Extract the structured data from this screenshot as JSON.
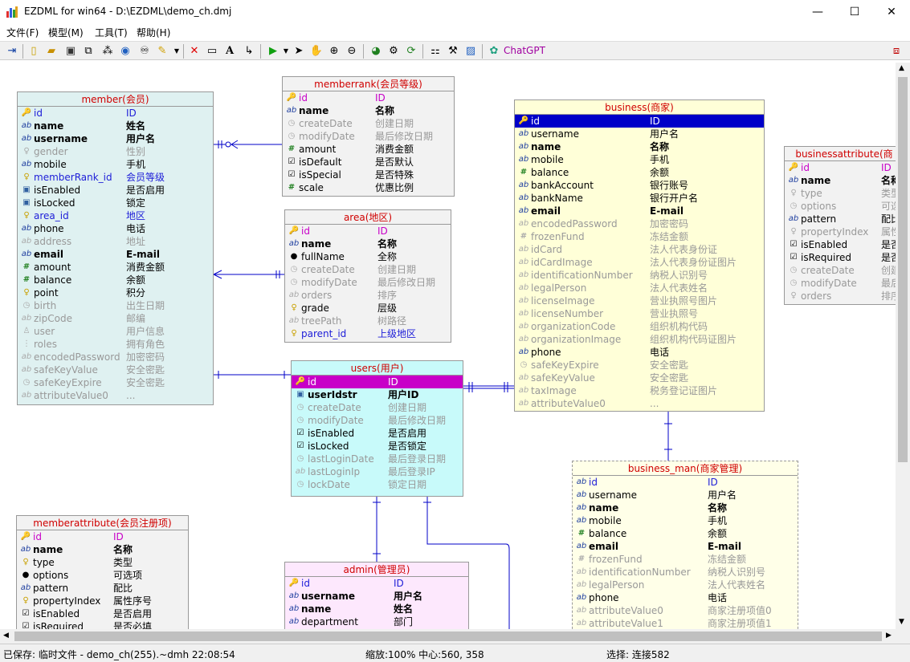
{
  "window": {
    "title": "EZDML for win64 - D:\\EZDML\\demo_ch.dmj",
    "min": "—",
    "max": "☐",
    "close": "✕"
  },
  "menu": [
    "文件(F)",
    "模型(M)",
    "工具(T)",
    "帮助(H)"
  ],
  "toolbar": {
    "chatgpt": "ChatGPT"
  },
  "status": {
    "saved": "已保存: 临时文件 - demo_ch(255).~dmh 22:08:54",
    "zoom": "缩放:100% 中心:560, 358",
    "select": "选择: 连接582"
  },
  "tables": {
    "member": {
      "title": "member(会员)",
      "rows": [
        {
          "i": "🔑",
          "n": "id",
          "d": "ID",
          "c": "bl"
        },
        {
          "i": "ab",
          "n": "name",
          "d": "姓名",
          "c": "b"
        },
        {
          "i": "ab",
          "n": "username",
          "d": "用户名",
          "c": "b"
        },
        {
          "i": "♀",
          "n": "gender",
          "d": "性别",
          "c": "g"
        },
        {
          "i": "ab",
          "n": "mobile",
          "d": "手机",
          "c": ""
        },
        {
          "i": "♀",
          "n": "memberRank_id",
          "d": "会员等级",
          "c": "bl"
        },
        {
          "i": "▣",
          "n": "isEnabled",
          "d": "是否启用",
          "c": ""
        },
        {
          "i": "▣",
          "n": "isLocked",
          "d": "锁定",
          "c": ""
        },
        {
          "i": "♀",
          "n": "area_id",
          "d": "地区",
          "c": "bl"
        },
        {
          "i": "ab",
          "n": "phone",
          "d": "电话",
          "c": ""
        },
        {
          "i": "ab",
          "n": "address",
          "d": "地址",
          "c": "g"
        },
        {
          "i": "ab",
          "n": "email",
          "d": "E-mail",
          "c": "b"
        },
        {
          "i": "#",
          "n": "amount",
          "d": "消费金额",
          "c": ""
        },
        {
          "i": "#",
          "n": "balance",
          "d": "余额",
          "c": ""
        },
        {
          "i": "♀",
          "n": "point",
          "d": "积分",
          "c": ""
        },
        {
          "i": "◷",
          "n": "birth",
          "d": "出生日期",
          "c": "g"
        },
        {
          "i": "ab",
          "n": "zipCode",
          "d": "邮编",
          "c": "g"
        },
        {
          "i": "♙",
          "n": "user",
          "d": "用户信息",
          "c": "g"
        },
        {
          "i": "⋮",
          "n": "roles",
          "d": "拥有角色",
          "c": "g"
        },
        {
          "i": "ab",
          "n": "encodedPassword",
          "d": "加密密码",
          "c": "g"
        },
        {
          "i": "ab",
          "n": "safeKeyValue",
          "d": "安全密匙",
          "c": "g"
        },
        {
          "i": "◷",
          "n": "safeKeyExpire",
          "d": "安全密匙",
          "c": "g"
        },
        {
          "i": "ab",
          "n": "attributeValue0",
          "d": "...",
          "c": "g"
        }
      ]
    },
    "memberrank": {
      "title": "memberrank(会员等级)",
      "rows": [
        {
          "i": "🔑",
          "n": "id",
          "d": "ID",
          "c": "pk"
        },
        {
          "i": "ab",
          "n": "name",
          "d": "名称",
          "c": "b"
        },
        {
          "i": "◷",
          "n": "createDate",
          "d": "创建日期",
          "c": "g"
        },
        {
          "i": "◷",
          "n": "modifyDate",
          "d": "最后修改日期",
          "c": "g"
        },
        {
          "i": "#",
          "n": "amount",
          "d": "消费金额",
          "c": ""
        },
        {
          "i": "☑",
          "n": "isDefault",
          "d": "是否默认",
          "c": ""
        },
        {
          "i": "☑",
          "n": "isSpecial",
          "d": "是否特殊",
          "c": ""
        },
        {
          "i": "#",
          "n": "scale",
          "d": "优惠比例",
          "c": ""
        }
      ]
    },
    "area": {
      "title": "area(地区)",
      "rows": [
        {
          "i": "🔑",
          "n": "id",
          "d": "ID",
          "c": "pk"
        },
        {
          "i": "ab",
          "n": "name",
          "d": "名称",
          "c": "b"
        },
        {
          "i": "●",
          "n": "fullName",
          "d": "全称",
          "c": ""
        },
        {
          "i": "◷",
          "n": "createDate",
          "d": "创建日期",
          "c": "g"
        },
        {
          "i": "◷",
          "n": "modifyDate",
          "d": "最后修改日期",
          "c": "g"
        },
        {
          "i": "ab",
          "n": "orders",
          "d": "排序",
          "c": "g"
        },
        {
          "i": "♀",
          "n": "grade",
          "d": "层级",
          "c": ""
        },
        {
          "i": "ab",
          "n": "treePath",
          "d": "树路径",
          "c": "g"
        },
        {
          "i": "♀",
          "n": "parent_id",
          "d": "上级地区",
          "c": "bl"
        }
      ]
    },
    "users": {
      "title": "users(用户)",
      "rows": [
        {
          "i": "🔑",
          "n": "id",
          "d": "ID",
          "c": "selp"
        },
        {
          "i": "▣",
          "n": "userIdstr",
          "d": "用户ID",
          "c": "b"
        },
        {
          "i": "◷",
          "n": "createDate",
          "d": "创建日期",
          "c": "g"
        },
        {
          "i": "◷",
          "n": "modifyDate",
          "d": "最后修改日期",
          "c": "g"
        },
        {
          "i": "☑",
          "n": "isEnabled",
          "d": "是否启用",
          "c": ""
        },
        {
          "i": "☑",
          "n": "isLocked",
          "d": "是否锁定",
          "c": ""
        },
        {
          "i": "◷",
          "n": "lastLoginDate",
          "d": "最后登录日期",
          "c": "g"
        },
        {
          "i": "ab",
          "n": "lastLoginIp",
          "d": "最后登录IP",
          "c": "g"
        },
        {
          "i": "◷",
          "n": "lockDate",
          "d": "锁定日期",
          "c": "g"
        }
      ]
    },
    "business": {
      "title": "business(商家)",
      "rows": [
        {
          "i": "🔑",
          "n": "id",
          "d": "ID",
          "c": "sel"
        },
        {
          "i": "ab",
          "n": "username",
          "d": "用户名",
          "c": ""
        },
        {
          "i": "ab",
          "n": "name",
          "d": "名称",
          "c": "b"
        },
        {
          "i": "ab",
          "n": "mobile",
          "d": "手机",
          "c": ""
        },
        {
          "i": "#",
          "n": "balance",
          "d": "余额",
          "c": ""
        },
        {
          "i": "ab",
          "n": "bankAccount",
          "d": "银行账号",
          "c": ""
        },
        {
          "i": "ab",
          "n": "bankName",
          "d": "银行开户名",
          "c": ""
        },
        {
          "i": "ab",
          "n": "email",
          "d": "E-mail",
          "c": "b"
        },
        {
          "i": "ab",
          "n": "encodedPassword",
          "d": "加密密码",
          "c": "g"
        },
        {
          "i": "#",
          "n": "frozenFund",
          "d": "冻结金额",
          "c": "g"
        },
        {
          "i": "ab",
          "n": "idCard",
          "d": "法人代表身份证",
          "c": "g"
        },
        {
          "i": "ab",
          "n": "idCardImage",
          "d": "法人代表身份证图片",
          "c": "g"
        },
        {
          "i": "ab",
          "n": "identificationNumber",
          "d": "纳税人识别号",
          "c": "g"
        },
        {
          "i": "ab",
          "n": "legalPerson",
          "d": "法人代表姓名",
          "c": "g"
        },
        {
          "i": "ab",
          "n": "licenseImage",
          "d": "营业执照号图片",
          "c": "g"
        },
        {
          "i": "ab",
          "n": "licenseNumber",
          "d": "营业执照号",
          "c": "g"
        },
        {
          "i": "ab",
          "n": "organizationCode",
          "d": "组织机构代码",
          "c": "g"
        },
        {
          "i": "ab",
          "n": "organizationImage",
          "d": "组织机构代码证图片",
          "c": "g"
        },
        {
          "i": "ab",
          "n": "phone",
          "d": "电话",
          "c": ""
        },
        {
          "i": "◷",
          "n": "safeKeyExpire",
          "d": "安全密匙",
          "c": "g"
        },
        {
          "i": "ab",
          "n": "safeKeyValue",
          "d": "安全密匙",
          "c": "g"
        },
        {
          "i": "ab",
          "n": "taxImage",
          "d": "税务登记证图片",
          "c": "g"
        },
        {
          "i": "ab",
          "n": "attributeValue0",
          "d": "...",
          "c": "g"
        }
      ]
    },
    "businessattribute": {
      "title": "businessattribute(商",
      "rows": [
        {
          "i": "🔑",
          "n": "id",
          "d": "ID",
          "c": "pk"
        },
        {
          "i": "ab",
          "n": "name",
          "d": "名称",
          "c": "b"
        },
        {
          "i": "♀",
          "n": "type",
          "d": "类型",
          "c": "g"
        },
        {
          "i": "◷",
          "n": "options",
          "d": "可选",
          "c": "g"
        },
        {
          "i": "ab",
          "n": "pattern",
          "d": "配比",
          "c": ""
        },
        {
          "i": "♀",
          "n": "propertyIndex",
          "d": "属性",
          "c": "g"
        },
        {
          "i": "☑",
          "n": "isEnabled",
          "d": "是否",
          "c": ""
        },
        {
          "i": "☑",
          "n": "isRequired",
          "d": "是否",
          "c": ""
        },
        {
          "i": "◷",
          "n": "createDate",
          "d": "创建",
          "c": "g"
        },
        {
          "i": "◷",
          "n": "modifyDate",
          "d": "最后",
          "c": "g"
        },
        {
          "i": "♀",
          "n": "orders",
          "d": "排序",
          "c": "g"
        }
      ]
    },
    "businessman": {
      "title": "business_man(商家管理)",
      "rows": [
        {
          "i": "ab",
          "n": "id",
          "d": "ID",
          "c": "bl"
        },
        {
          "i": "ab",
          "n": "username",
          "d": "用户名",
          "c": ""
        },
        {
          "i": "ab",
          "n": "name",
          "d": "名称",
          "c": "b"
        },
        {
          "i": "ab",
          "n": "mobile",
          "d": "手机",
          "c": ""
        },
        {
          "i": "#",
          "n": "balance",
          "d": "余额",
          "c": ""
        },
        {
          "i": "ab",
          "n": "email",
          "d": "E-mail",
          "c": "b"
        },
        {
          "i": "#",
          "n": "frozenFund",
          "d": "冻结金额",
          "c": "g"
        },
        {
          "i": "ab",
          "n": "identificationNumber",
          "d": "纳税人识别号",
          "c": "g"
        },
        {
          "i": "ab",
          "n": "legalPerson",
          "d": "法人代表姓名",
          "c": "g"
        },
        {
          "i": "ab",
          "n": "phone",
          "d": "电话",
          "c": ""
        },
        {
          "i": "ab",
          "n": "attributeValue0",
          "d": "商家注册项值0",
          "c": "g"
        },
        {
          "i": "ab",
          "n": "attributeValue1",
          "d": "商家注册项值1",
          "c": "g"
        }
      ]
    },
    "memberattribute": {
      "title": "memberattribute(会员注册项)",
      "rows": [
        {
          "i": "🔑",
          "n": "id",
          "d": "ID",
          "c": "pk"
        },
        {
          "i": "ab",
          "n": "name",
          "d": "名称",
          "c": "b"
        },
        {
          "i": "♀",
          "n": "type",
          "d": "类型",
          "c": ""
        },
        {
          "i": "●",
          "n": "options",
          "d": "可选项",
          "c": ""
        },
        {
          "i": "ab",
          "n": "pattern",
          "d": "配比",
          "c": ""
        },
        {
          "i": "♀",
          "n": "propertyIndex",
          "d": "属性序号",
          "c": ""
        },
        {
          "i": "☑",
          "n": "isEnabled",
          "d": "是否启用",
          "c": ""
        },
        {
          "i": "☑",
          "n": "isRequired",
          "d": "是否必填",
          "c": ""
        }
      ]
    },
    "admin": {
      "title": "admin(管理员)",
      "rows": [
        {
          "i": "🔑",
          "n": "id",
          "d": "ID",
          "c": "bl"
        },
        {
          "i": "ab",
          "n": "username",
          "d": "用户名",
          "c": "b"
        },
        {
          "i": "ab",
          "n": "name",
          "d": "姓名",
          "c": "b"
        },
        {
          "i": "ab",
          "n": "department",
          "d": "部门",
          "c": ""
        }
      ]
    }
  }
}
